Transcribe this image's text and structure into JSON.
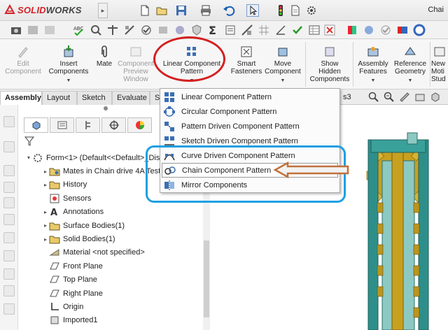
{
  "app": {
    "logo_brand": "3S",
    "logo_text_main": "SOLID",
    "logo_text_tail": "WORKS",
    "window_title": "Chai"
  },
  "ribbon": {
    "items": [
      {
        "id": "edit-component",
        "label": "Edit\nComponent",
        "enabled": false,
        "icon": "edit-component-icon"
      },
      {
        "id": "insert-components",
        "label": "Insert\nComponents",
        "enabled": true,
        "icon": "insert-components-icon"
      },
      {
        "id": "mate",
        "label": "Mate",
        "enabled": true,
        "icon": "paperclip-icon"
      },
      {
        "id": "component-preview-window",
        "label": "Component\nPreview\nWindow",
        "enabled": false,
        "icon": "preview-window-icon"
      },
      {
        "id": "linear-component-pattern",
        "label": "Linear Component\nPattern",
        "enabled": true,
        "icon": "linear-pattern-icon"
      },
      {
        "id": "smart-fasteners",
        "label": "Smart\nFasteners",
        "enabled": true,
        "icon": "smart-fasteners-icon"
      },
      {
        "id": "move-component",
        "label": "Move\nComponent",
        "enabled": true,
        "icon": "move-component-icon"
      },
      {
        "id": "show-hidden-components",
        "label": "Show\nHidden\nComponents",
        "enabled": true,
        "icon": "show-hidden-icon"
      },
      {
        "id": "assembly-features",
        "label": "Assembly\nFeatures",
        "enabled": true,
        "icon": "assembly-features-icon"
      },
      {
        "id": "reference-geometry",
        "label": "Reference\nGeometry",
        "enabled": true,
        "icon": "reference-geometry-icon"
      },
      {
        "id": "new-motion-study",
        "label": "New\nMoti\nStud",
        "enabled": true,
        "icon": "motion-study-icon"
      }
    ]
  },
  "tabs": [
    "Assembly",
    "Layout",
    "Sketch",
    "Evaluate",
    "S",
    "s3"
  ],
  "active_tab": "Assembly",
  "menu": {
    "items": [
      {
        "label": "Linear Component Pattern",
        "icon": "linear-pattern-icon",
        "highlighted": false
      },
      {
        "label": "Circular Component Pattern",
        "icon": "circular-pattern-icon",
        "highlighted": false
      },
      {
        "label": "Pattern Driven Component Pattern",
        "icon": "pattern-driven-icon",
        "highlighted": false
      },
      {
        "label": "Sketch Driven Component Pattern",
        "icon": "sketch-driven-icon",
        "highlighted": false
      },
      {
        "label": "Curve Driven Component Pattern",
        "icon": "curve-driven-icon",
        "highlighted": false
      },
      {
        "label": "Chain Component Pattern",
        "icon": "chain-pattern-icon",
        "highlighted": true
      },
      {
        "label": "Mirror Components",
        "icon": "mirror-components-icon",
        "highlighted": false
      }
    ]
  },
  "tree": {
    "root_label": "Form<1> (Default<<Default>_Dis",
    "items": [
      {
        "label": "Mates in Chain drive 4A Test",
        "expandable": true,
        "icon": "mates-folder-icon"
      },
      {
        "label": "History",
        "expandable": true,
        "icon": "history-folder-icon"
      },
      {
        "label": "Sensors",
        "expandable": false,
        "icon": "sensors-icon"
      },
      {
        "label": "Annotations",
        "expandable": true,
        "icon": "annotations-icon"
      },
      {
        "label": "Surface Bodies(1)",
        "expandable": true,
        "icon": "surface-bodies-icon"
      },
      {
        "label": "Solid Bodies(1)",
        "expandable": true,
        "icon": "solid-bodies-icon"
      },
      {
        "label": "Material <not specified>",
        "expandable": false,
        "icon": "material-icon"
      },
      {
        "label": "Front Plane",
        "expandable": false,
        "icon": "plane-icon"
      },
      {
        "label": "Top Plane",
        "expandable": false,
        "icon": "plane-icon"
      },
      {
        "label": "Right Plane",
        "expandable": false,
        "icon": "plane-icon"
      },
      {
        "label": "Origin",
        "expandable": false,
        "icon": "origin-icon"
      },
      {
        "label": "Imported1",
        "expandable": false,
        "icon": "imported-body-icon"
      }
    ]
  },
  "colors": {
    "brand_red": "#d2232a",
    "annotation_red": "#d42020",
    "annotation_blue": "#1ea0e2",
    "annotation_arrow": "#c0703a",
    "model_teal": "#2e8f8a",
    "model_gold": "#c8a020"
  }
}
